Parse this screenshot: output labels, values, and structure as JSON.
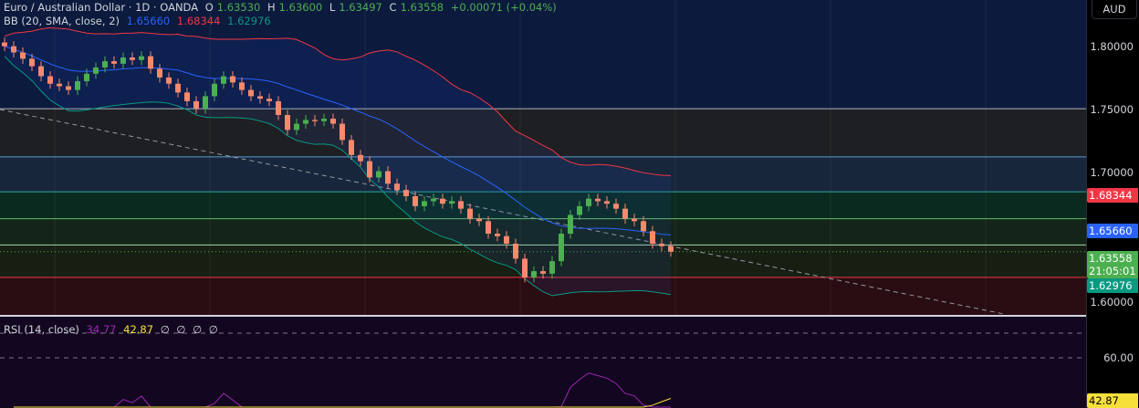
{
  "header": {
    "symbol": "Euro / Australian Dollar · 1D · OANDA",
    "o_label": "O",
    "o": "1.63530",
    "h_label": "H",
    "h": "1.63600",
    "l_label": "L",
    "l": "1.63497",
    "c_label": "C",
    "c": "1.63558",
    "change": "+0.00071 (+0.04%)"
  },
  "bb_legend": {
    "label": "BB (20, SMA, close, 2)",
    "basis": "1.65660",
    "upper": "1.68344",
    "lower": "1.62976"
  },
  "rsi_legend": {
    "label": "RSI (14, close)",
    "rsi": "34.77",
    "ma": "42.87",
    "empty": [
      "∅",
      "∅",
      "∅",
      "∅"
    ]
  },
  "currency_button": "AUD",
  "price_ticks": [
    "1.80000",
    "1.75000",
    "1.70000",
    "1.60000"
  ],
  "rsi_ticks": [
    "60.00"
  ],
  "tags": {
    "upper": "1.68344",
    "basis": "1.65660",
    "close": "1.63558",
    "countdown": "21:05:01",
    "lower": "1.62976",
    "rsi_ma": "42.87"
  },
  "colors": {
    "up": "#4caf50",
    "down": "#f7896d",
    "upper": "#f23645",
    "basis": "#2962ff",
    "lower": "#089981",
    "rsi": "#9c27b0",
    "rsi_ma": "#f7e03a"
  },
  "chart_data": {
    "type": "candlestick",
    "ylim": [
      1.585,
      1.837
    ],
    "levels": [
      1.75,
      1.7115,
      1.6835,
      1.662,
      1.641,
      1.615
    ],
    "closes": [
      1.8,
      1.795,
      1.79,
      1.784,
      1.776,
      1.77,
      1.768,
      1.765,
      1.772,
      1.778,
      1.783,
      1.788,
      1.786,
      1.791,
      1.789,
      1.792,
      1.782,
      1.775,
      1.77,
      1.763,
      1.756,
      1.75,
      1.76,
      1.77,
      1.776,
      1.771,
      1.765,
      1.76,
      1.758,
      1.756,
      1.745,
      1.733,
      1.738,
      1.741,
      1.74,
      1.742,
      1.738,
      1.725,
      1.713,
      1.708,
      1.695,
      1.7,
      1.69,
      1.685,
      1.68,
      1.672,
      1.676,
      1.678,
      1.674,
      1.676,
      1.67,
      1.662,
      1.66,
      1.65,
      1.648,
      1.642,
      1.63,
      1.615,
      1.62,
      1.618,
      1.628,
      1.65,
      1.665,
      1.672,
      1.678,
      1.676,
      1.674,
      1.67,
      1.662,
      1.66,
      1.652,
      1.642,
      1.64,
      1.63558
    ],
    "rsi_levels": [
      70,
      60
    ]
  }
}
